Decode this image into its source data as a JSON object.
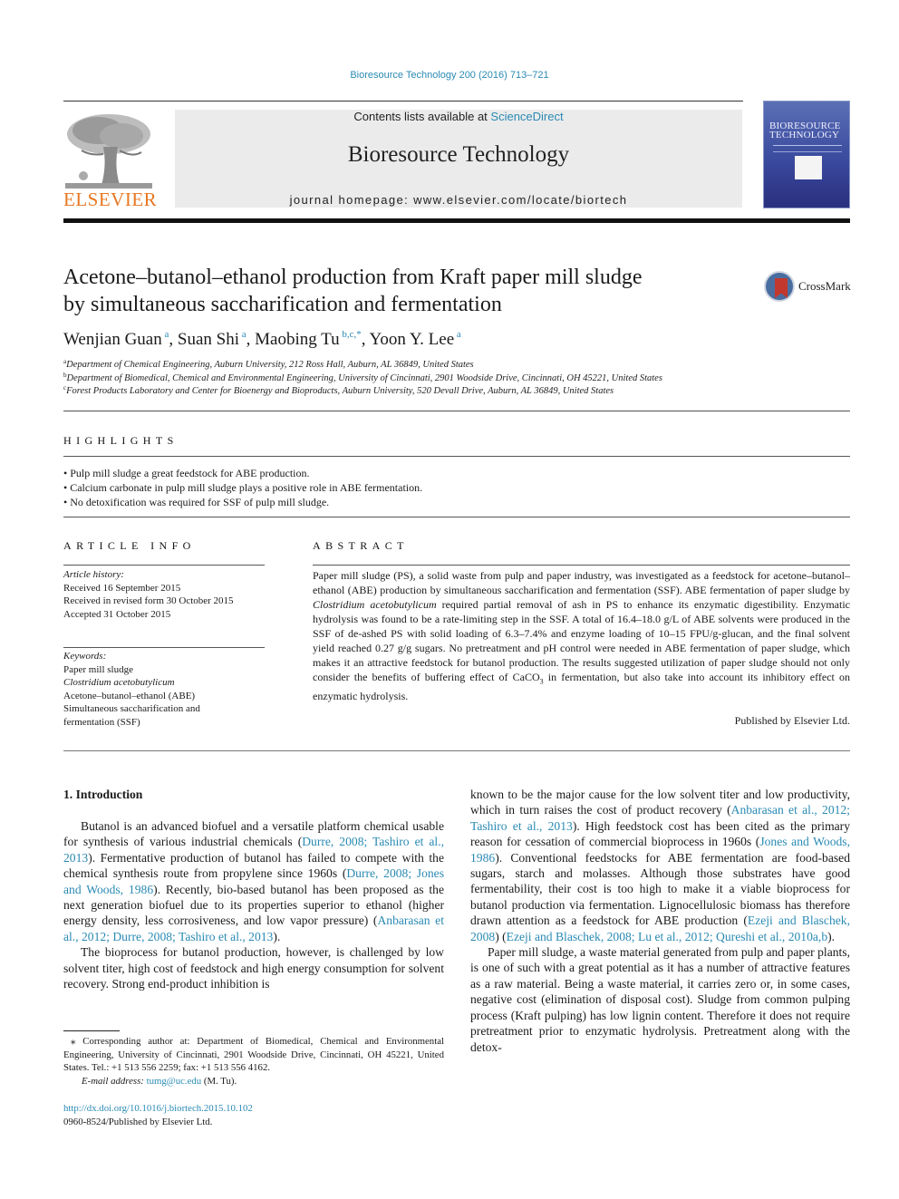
{
  "header": {
    "citation": "Bioresource Technology 200 (2016) 713–721",
    "contents_prefix": "Contents lists available at ",
    "contents_link": "ScienceDirect",
    "journal_title": "Bioresource Technology",
    "homepage": "journal homepage: www.elsevier.com/locate/biortech",
    "publisher_logo_text": "ELSEVIER",
    "cover_title_line1": "BIORESOURCE",
    "cover_title_line2": "TECHNOLOGY",
    "colors": {
      "link": "#2a8ab4",
      "elsevier_orange": "#e87722",
      "banner_gray": "#ebebeb"
    }
  },
  "article": {
    "title_line1": "Acetone–butanol–ethanol production from Kraft paper mill sludge",
    "title_line2": "by simultaneous saccharification and fermentation",
    "crossmark_label": "CrossMark",
    "authors": [
      {
        "name": "Wenjian Guan",
        "sup": "a",
        "sep": ", "
      },
      {
        "name": "Suan Shi",
        "sup": "a",
        "sep": ", "
      },
      {
        "name": "Maobing Tu",
        "sup": "b,c,*",
        "sep": ", "
      },
      {
        "name": "Yoon Y. Lee",
        "sup": "a",
        "sep": ""
      }
    ],
    "affiliations": [
      {
        "mark": "a",
        "text": "Department of Chemical Engineering, Auburn University, 212 Ross Hall, Auburn, AL 36849, United States"
      },
      {
        "mark": "b",
        "text": "Department of Biomedical, Chemical and Environmental Engineering, University of Cincinnati, 2901 Woodside Drive, Cincinnati, OH 45221, United States"
      },
      {
        "mark": "c",
        "text": "Forest Products Laboratory and Center for Bioenergy and Bioproducts, Auburn University, 520 Devall Drive, Auburn, AL 36849, United States"
      }
    ]
  },
  "highlights": {
    "heading": "HIGHLIGHTS",
    "items": [
      "Pulp mill sludge a great feedstock for ABE production.",
      "Calcium carbonate in pulp mill sludge plays a positive role in ABE fermentation.",
      "No detoxification was required for SSF of pulp mill sludge."
    ]
  },
  "article_info": {
    "heading": "ARTICLE INFO",
    "history_label": "Article history:",
    "history": [
      "Received 16 September 2015",
      "Received in revised form 30 October 2015",
      "Accepted 31 October 2015"
    ],
    "keywords_label": "Keywords:",
    "keywords": [
      {
        "text": "Paper mill sludge",
        "italic": false
      },
      {
        "text": "Clostridium acetobutylicum",
        "italic": true
      },
      {
        "text": "Acetone–butanol–ethanol (ABE)",
        "italic": false
      },
      {
        "text": "Simultaneous saccharification and",
        "italic": false
      },
      {
        "text": "fermentation (SSF)",
        "italic": false
      }
    ]
  },
  "abstract": {
    "heading": "ABSTRACT",
    "part1": "Paper mill sludge (PS), a solid waste from pulp and paper industry, was investigated as a feedstock for acetone–butanol–ethanol (ABE) production by simultaneous saccharification and fermentation (SSF). ABE fermentation of paper sludge by ",
    "organism": "Clostridium acetobutylicum",
    "part2": " required partial removal of ash in PS to enhance its enzymatic digestibility. Enzymatic hydrolysis was found to be a rate-limiting step in the SSF. A total of 16.4–18.0 g/L of ABE solvents were produced in the SSF of de-ashed PS with solid loading of 6.3–7.4% and enzyme loading of 10–15 FPU/g-glucan, and the final solvent yield reached 0.27 g/g sugars. No pretreatment and pH control were needed in ABE fermentation of paper sludge, which makes it an attractive feedstock for butanol production. The results suggested utilization of paper sludge should not only consider the benefits of buffering effect of CaCO",
    "sub3": "3",
    "part3": " in fermentation, but also take into account its inhibitory effect on enzymatic hydrolysis.",
    "published": "Published by Elsevier Ltd."
  },
  "introduction": {
    "heading": "1. Introduction",
    "left_p1": [
      {
        "t": "Butanol is an advanced biofuel and a versatile platform chemical usable for synthesis of various industrial chemicals ("
      },
      {
        "t": "Durre, 2008; Tashiro et al., 2013",
        "link": true
      },
      {
        "t": "). Fermentative production of butanol has failed to compete with the chemical synthesis route from propylene since 1960s ("
      },
      {
        "t": "Durre, 2008; Jones and Woods, 1986",
        "link": true
      },
      {
        "t": "). Recently, bio-based butanol has been proposed as the next generation biofuel due to its properties superior to ethanol (higher energy density, less corrosiveness, and low vapor pressure) ("
      },
      {
        "t": "Anbarasan et al., 2012; Durre, 2008; Tashiro et al., 2013",
        "link": true
      },
      {
        "t": ")."
      }
    ],
    "left_p2": [
      {
        "t": "The bioprocess for butanol production, however, is challenged by low solvent titer, high cost of feedstock and high energy consumption for solvent recovery. Strong end-product inhibition is"
      }
    ],
    "right_p1": [
      {
        "t": "known to be the major cause for the low solvent titer and low productivity, which in turn raises the cost of product recovery ("
      },
      {
        "t": "Anbarasan et al., 2012; Tashiro et al., 2013",
        "link": true
      },
      {
        "t": "). High feedstock cost has been cited as the primary reason for cessation of commercial bioprocess in 1960s ("
      },
      {
        "t": "Jones and Woods, 1986",
        "link": true
      },
      {
        "t": "). Conventional feedstocks for ABE fermentation are food-based sugars, starch and molasses. Although those substrates have good fermentability, their cost is too high to make it a viable bioprocess for butanol production via fermentation. Lignocellulosic biomass has therefore drawn attention as a feedstock for ABE production ("
      },
      {
        "t": "Ezeji and Blaschek, 2008",
        "link": true
      },
      {
        "t": ") ("
      },
      {
        "t": "Ezeji and Blaschek, 2008; Lu et al., 2012; Qureshi et al., 2010a,b",
        "link": true
      },
      {
        "t": ")."
      }
    ],
    "right_p2": [
      {
        "t": "Paper mill sludge, a waste material generated from pulp and paper plants, is one of such with a great potential as it has a number of attractive features as a raw material. Being a waste material, it carries zero or, in some cases, negative cost (elimination of disposal cost). Sludge from common pulping process (Kraft pulping) has low lignin content. Therefore it does not require pretreatment prior to enzymatic hydrolysis. Pretreatment along with the detox-"
      }
    ]
  },
  "footnote": {
    "star": "⁎",
    "corresponding": " Corresponding author at: Department of Biomedical, Chemical and Environmental Engineering, University of Cincinnati, 2901 Woodside Drive, Cincinnati, OH 45221, United States. Tel.: +1 513 556 2259; fax: +1 513 556 4162.",
    "email_label": "E-mail address: ",
    "email": "tumg@uc.edu",
    "email_suffix": " (M. Tu).",
    "doi": "http://dx.doi.org/10.1016/j.biortech.2015.10.102",
    "issn": "0960-8524/Published by Elsevier Ltd."
  }
}
